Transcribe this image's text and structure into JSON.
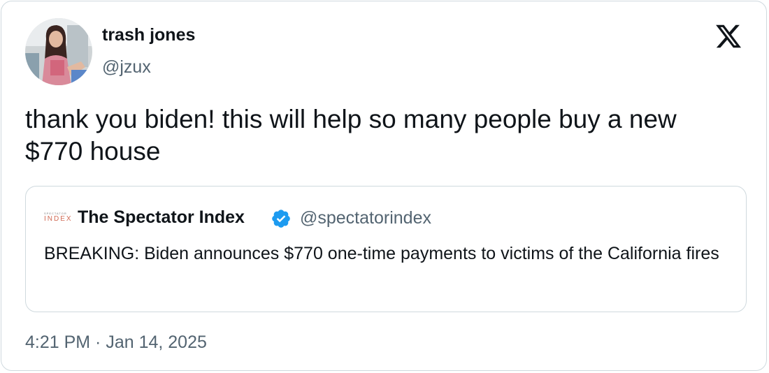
{
  "tweet": {
    "author": {
      "display_name": "trash jones",
      "handle": "@jzux",
      "avatar_icon": "profile-photo"
    },
    "brand_icon": "x-logo-icon",
    "text": "thank you biden! this will help so many people buy a new $770 house",
    "timestamp": "4:21 PM · Jan 14, 2025"
  },
  "quoted_tweet": {
    "logo_small": "SPECTATOR",
    "logo_big": "INDEX",
    "display_name": "The Spectator Index",
    "verified_icon": "verified-badge-icon",
    "handle": "@spectatorindex",
    "text": "BREAKING: Biden announces $770 one-time payments to victims of the California fires"
  },
  "colors": {
    "text_primary": "#0f1419",
    "text_secondary": "#536471",
    "border": "#cfd9de",
    "verified_blue": "#1d9bf0"
  }
}
